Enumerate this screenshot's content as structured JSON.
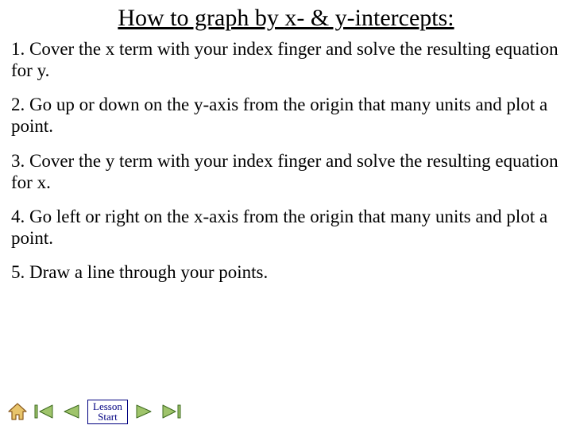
{
  "title": "How to graph by x- & y-intercepts:",
  "steps": [
    "1. Cover the x term with your index finger and solve the resulting equation for y.",
    "2. Go up or down on the y-axis from the origin that many units and plot a point.",
    "3. Cover the y term with your index finger and solve the resulting equation for x.",
    "4. Go left or right on the x-axis from the origin that many units and plot a point.",
    "5. Draw a line through your points."
  ],
  "nav": {
    "lesson_start_line1": "Lesson",
    "lesson_start_line2": "Start"
  },
  "colors": {
    "nav_fill": "#9FC46B",
    "nav_stroke": "#3E6B1F",
    "home_fill": "#E8C46B",
    "home_stroke": "#8A5A1E",
    "accent": "#000080"
  }
}
